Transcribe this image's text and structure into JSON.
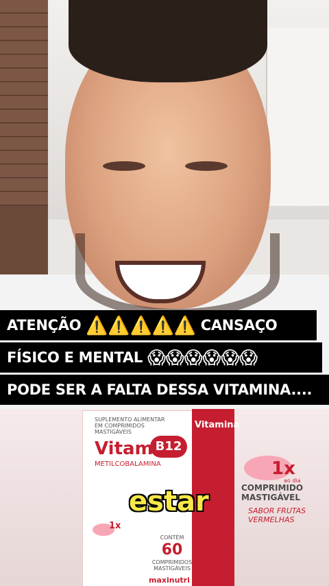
{
  "caption": {
    "line1_a": "ATENÇÃO",
    "line1_emoji": "⚠️⚠️⚠️⚠️⚠️",
    "line1_b": "CANSAÇO",
    "line2_a": "FÍSICO E MENTAL",
    "line2_emoji": "😱😱😱😱😱😱",
    "line3": "PODE SER A FALTA DESSA VITAMINA...."
  },
  "subtitle_word": "estar",
  "product": {
    "box_top_text": "SUPLEMENTO ALIMENTAR EM COMPRIMIDOS MASTIGÁVEIS",
    "name": "Vitamina",
    "variant": "B12",
    "compound": "METILCOBALAMINA",
    "count_label": "CONTÉM",
    "count": "60",
    "count_unit": "COMPRIMIDOS MASTIGÁVEIS",
    "brand": "maxinutri",
    "dose_badge": "1x",
    "dose_sub": "ao dia",
    "dose_label_1": "COMPRIMIDO",
    "dose_label_2": "MASTIGÁVEL",
    "flavor_1": "SABOR FRUTAS",
    "flavor_2": "VERMELHAS"
  },
  "colors": {
    "caption_bg": "#000000",
    "caption_text": "#ffffff",
    "brand_red": "#c51e30",
    "subtitle_yellow": "#f7e84a"
  }
}
